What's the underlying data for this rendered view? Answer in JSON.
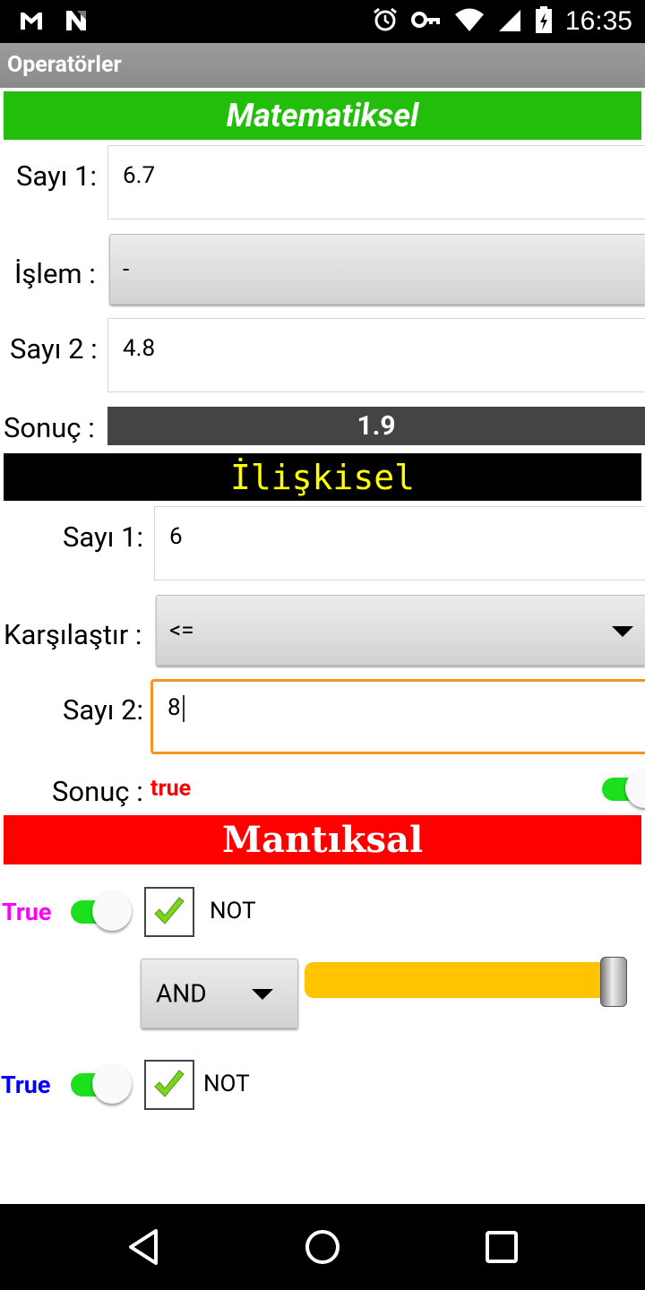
{
  "status_bar": {
    "time": "16:35",
    "icons": [
      "gmail-icon",
      "n-icon",
      "alarm-icon",
      "key-icon",
      "wifi-icon",
      "signal-icon",
      "battery-charging-icon"
    ]
  },
  "app": {
    "title": "Operatörler"
  },
  "math": {
    "header": "Matematiksel",
    "num1_label": "Sayı 1:",
    "num1_value": "6.7",
    "op_label": "İşlem :",
    "op_value": "-",
    "num2_label": "Sayı 2 :",
    "num2_value": "4.8",
    "result_label": "Sonuç :",
    "result_value": "1.9"
  },
  "relational": {
    "header": "İlişkisel",
    "num1_label": "Sayı 1:",
    "num1_value": "6",
    "compare_label": "Karşılaştır :",
    "compare_value": "<=",
    "num2_label": "Sayı 2:",
    "num2_value": "8",
    "result_label": "Sonuç :",
    "result_value": "true",
    "result_switch_on": true
  },
  "logical": {
    "header": "Mantıksal",
    "row1": {
      "value_label": "True",
      "value_color": "#ff00ff",
      "switch_on": true,
      "not_checked": true,
      "not_label": "NOT"
    },
    "operator_value": "AND",
    "slider_value": 1.0,
    "row2": {
      "value_label": "True",
      "value_color": "#0000ff",
      "switch_on": true,
      "not_checked": true,
      "not_label": "NOT"
    }
  },
  "colors": {
    "math_header": "#23bd0c",
    "relational_header": "#000000",
    "relational_text": "#ffff00",
    "logical_header": "#ff0000",
    "result_true": "#ff0000",
    "slider_track": "#ffc300",
    "switch_on": "#1be01b",
    "focus_border": "#f7941d"
  }
}
